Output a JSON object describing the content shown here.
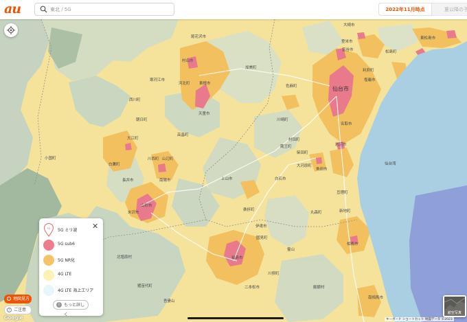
{
  "brand": {
    "logo_text": "au",
    "accent": "#eb5505"
  },
  "search": {
    "placeholder": "東北 / 5G",
    "icon": "search-icon"
  },
  "tabs": [
    {
      "label": "2022年11月時点",
      "active": true
    },
    {
      "label": "夏以降の予",
      "active": false
    }
  ],
  "legend": {
    "close_label": "✕",
    "items": [
      {
        "label": "5G ミリ波",
        "color": "#ffffff",
        "icon": "pin-icon"
      },
      {
        "label": "5G sub6",
        "color": "#ee7c8b"
      },
      {
        "label": "5G NR化",
        "color": "#f5c469"
      },
      {
        "label": "4G LTE",
        "color": "#fbf2b3"
      },
      {
        "label": "4G LTE 海上エリア",
        "color": "#e7f6f8"
      }
    ],
    "more_label": "もっと詳しく"
  },
  "controls": {
    "area_button": "地図見方",
    "notice_button": "ご注意"
  },
  "map": {
    "google_label": "Google",
    "attribution": "キーボード ショートカット  地図データ ©2023",
    "aerial_label": "航空写真",
    "colors": {
      "sea": "#aacfe2",
      "sea_deep": "#8f9fd8",
      "lte": "#f7e7a0",
      "nr": "#f2c05f",
      "sub6": "#e87a8c",
      "land": "#c9d9c7"
    },
    "labels": {
      "sendai": "仙台市",
      "yamagata": "山形市",
      "fukushima": "福島市",
      "kakuda": "角田市",
      "shiroishi": "白石市",
      "murata": "村田町",
      "shibata": "柴田町",
      "iwanuma": "岩沼市",
      "watari": "亘理町",
      "natori": "名取市",
      "osaki": "大崎市",
      "tome": "登米市",
      "ishinomaki": "石巻市",
      "shiogama": "塩竈市",
      "rifu": "利府町",
      "tomiya": "富谷市",
      "taiwa": "大和町",
      "ohira": "大衡村",
      "osato": "大郷町",
      "matsushima": "松島町",
      "higashimatsushima": "東松島市",
      "kawasaki": "川崎町",
      "zao": "蔵王町",
      "ogawara": "大河原町",
      "marumori": "丸森町",
      "soma": "相馬市",
      "shinchi": "新地町",
      "kami": "加美町",
      "shikama": "色麻町",
      "oishida": "大石田町",
      "obanazawa": "尾花沢市",
      "murayama": "村山市",
      "higashine": "東根市",
      "tendo": "天童市",
      "sagae": "寒河江市",
      "kahoku": "河北町",
      "nishikawa": "西川町",
      "asahi": "朝日町",
      "oe": "大江町",
      "shirataka": "白鷹町",
      "nagai": "長井市",
      "iide": "飯豊町",
      "oguni": "小国町",
      "kawanishi": "川西町",
      "nanyo": "南陽市",
      "takahata": "高畠町",
      "yonezawa": "米沢市",
      "kaminoyama": "上山市",
      "yamanobe": "山辺町",
      "nakayama": "中山町",
      "date": "伊達市",
      "koori": "桑折町",
      "kunimi": "国見町",
      "kitashiobara": "北塩原村",
      "inawashiro": "猪苗代町",
      "nihonmatsu": "二本松市",
      "kawamata": "川俣町",
      "iitate": "飯舘村",
      "minamisoma": "南相馬市",
      "ryozen": "霊山",
      "azuma": "吾妻山",
      "sea_name": "仙台湾"
    }
  }
}
